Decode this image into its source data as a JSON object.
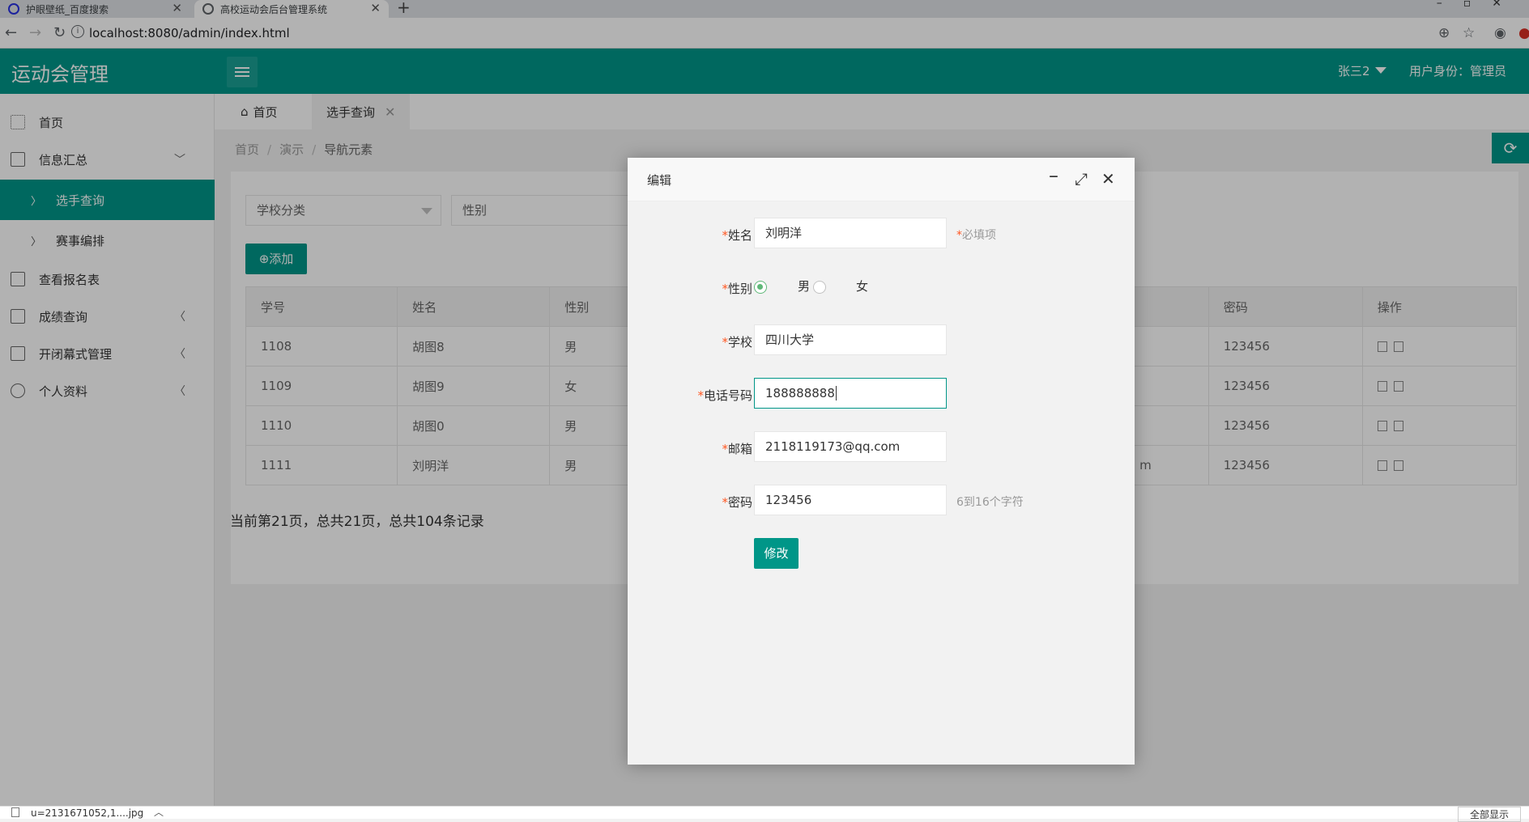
{
  "browser": {
    "tabs": [
      {
        "title": "护眼壁纸_百度搜索"
      },
      {
        "title": "高校运动会后台管理系统"
      }
    ],
    "url": "localhost:8080/admin/index.html"
  },
  "header": {
    "logo": "运动会管理",
    "user_name": "张三2",
    "user_role": "用户身份：管理员"
  },
  "sidebar": {
    "items": [
      {
        "label": "首页",
        "icon": "grid-icon"
      },
      {
        "label": "信息汇总",
        "icon": "file-icon"
      },
      {
        "label": "选手查询"
      },
      {
        "label": "赛事编排"
      },
      {
        "label": "查看报名表",
        "icon": "list-icon"
      },
      {
        "label": "成绩查询",
        "icon": "file-icon"
      },
      {
        "label": "开闭幕式管理",
        "icon": "file-icon"
      },
      {
        "label": "个人资料",
        "icon": "user-icon"
      }
    ]
  },
  "page_tabs": [
    {
      "label": "首页"
    },
    {
      "label": "选手查询"
    }
  ],
  "breadcrumb": [
    "首页",
    "演示",
    "导航元素"
  ],
  "filters": {
    "school": "学校分类",
    "gender": "性别"
  },
  "add_button": "添加",
  "table": {
    "headers": [
      "学号",
      "姓名",
      "性别",
      "密码",
      "操作"
    ],
    "rows": [
      {
        "id": "1108",
        "name": "胡图8",
        "gender": "男",
        "email_tail": "",
        "password": "123456"
      },
      {
        "id": "1109",
        "name": "胡图9",
        "gender": "女",
        "email_tail": "",
        "password": "123456"
      },
      {
        "id": "1110",
        "name": "胡图0",
        "gender": "男",
        "email_tail": "",
        "password": "123456"
      },
      {
        "id": "1111",
        "name": "刘明洋",
        "gender": "男",
        "email_tail": "m",
        "password": "123456"
      }
    ]
  },
  "pager": "当前第21页，总共21页，总共104条记录",
  "dialog": {
    "title": "编辑",
    "fields": {
      "name_label": "姓名",
      "name_value": "刘明洋",
      "name_hint": "必填项",
      "gender_label": "性别",
      "gender_male": "男",
      "gender_female": "女",
      "school_label": "学校",
      "school_value": "四川大学",
      "phone_label": "电话号码",
      "phone_value": "188888888",
      "email_label": "邮箱",
      "email_value": "2118119173@qq.com",
      "password_label": "密码",
      "password_value": "123456",
      "password_hint": "6到16个字符"
    },
    "submit": "修改"
  },
  "download_bar": {
    "file": "u=2131671052,1....jpg",
    "show_all": "全部显示"
  },
  "colors": {
    "primary": "#009688",
    "required": "#ff5722",
    "radio_on": "#5fb878"
  }
}
